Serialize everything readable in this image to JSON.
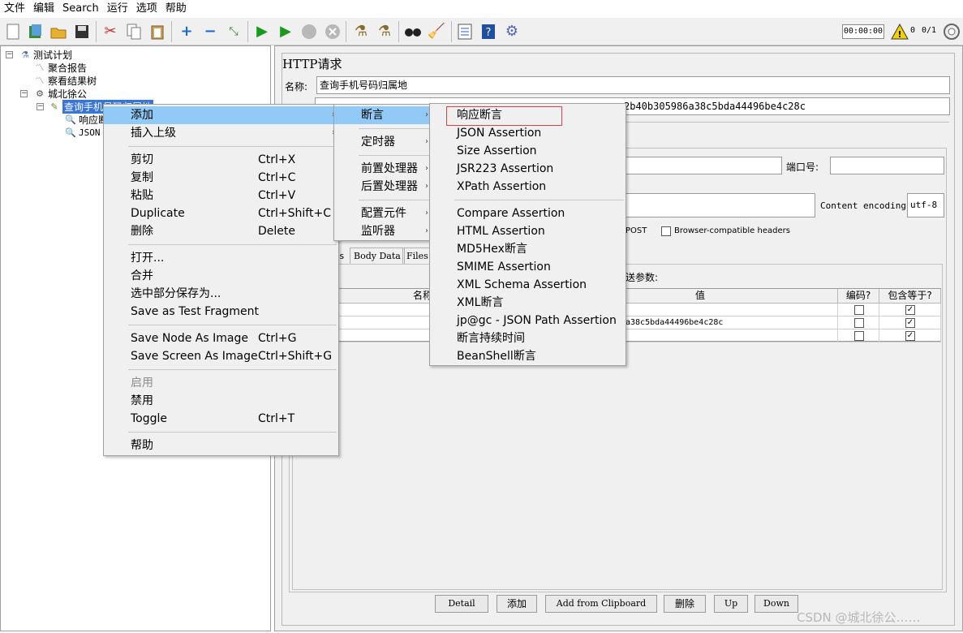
{
  "menubar": [
    "文件",
    "编辑",
    "Search",
    "运行",
    "选项",
    "帮助"
  ],
  "toolbar": {
    "timer": "00:00:00",
    "warning_count": "0",
    "thread_count": "0/1"
  },
  "tree": {
    "root": "测试计划",
    "aggregate_report": "聚合报告",
    "view_results_tree": "察看结果树",
    "thread_group": "城北徐公",
    "sampler": "查询手机号码归属地",
    "child_1": "响应断言",
    "child_2": "JSON"
  },
  "panel": {
    "title": "HTTP请求",
    "name_label": "名称:",
    "name_value": "查询手机号码归属地",
    "comment_visible": "2b40b305986a38c5bda44496be4c28c",
    "port_label": "端口号:",
    "encoding_label": "Content encoding:",
    "encoding_value": "utf-8",
    "post_label": "POST",
    "browser_headers_label": "Browser-compatible headers",
    "tab_params_visible": "s",
    "tab_body": "Body Data",
    "tab_files": "Files",
    "send_params_label": "送参数:",
    "table": {
      "columns": [
        "名称",
        "值",
        "编码?",
        "包含等于?"
      ],
      "rows": [
        {
          "value": "",
          "encode": false,
          "include_equals": true
        },
        {
          "value": "a38c5bda44496be4c28c",
          "encode": false,
          "include_equals": true
        },
        {
          "value": "",
          "encode": false,
          "include_equals": true
        }
      ]
    },
    "buttons": [
      "Detail",
      "添加",
      "Add from Clipboard",
      "删除",
      "Up",
      "Down"
    ]
  },
  "context_menu": {
    "items": [
      {
        "label": "添加",
        "shortcut": "",
        "submenu": true,
        "highlight": true
      },
      {
        "label": "插入上级",
        "shortcut": "",
        "submenu": true
      },
      {
        "label": "剪切",
        "shortcut": "Ctrl+X"
      },
      {
        "label": "复制",
        "shortcut": "Ctrl+C"
      },
      {
        "label": "粘贴",
        "shortcut": "Ctrl+V"
      },
      {
        "label": "Duplicate",
        "shortcut": "Ctrl+Shift+C"
      },
      {
        "label": "删除",
        "shortcut": "Delete"
      },
      {
        "label": "打开...",
        "shortcut": ""
      },
      {
        "label": "合并",
        "shortcut": ""
      },
      {
        "label": "选中部分保存为...",
        "shortcut": ""
      },
      {
        "label": "Save as Test Fragment",
        "shortcut": ""
      },
      {
        "label": "Save Node As Image",
        "shortcut": "Ctrl+G"
      },
      {
        "label": "Save Screen As Image",
        "shortcut": "Ctrl+Shift+G"
      },
      {
        "label": "启用",
        "shortcut": "",
        "disabled": true
      },
      {
        "label": "禁用",
        "shortcut": ""
      },
      {
        "label": "Toggle",
        "shortcut": "Ctrl+T"
      },
      {
        "label": "帮助",
        "shortcut": ""
      }
    ]
  },
  "add_submenu": {
    "items": [
      "断言",
      "定时器",
      "前置处理器",
      "后置处理器",
      "配置元件",
      "监听器"
    ]
  },
  "assertion_submenu": {
    "items": [
      "响应断言",
      "JSON Assertion",
      "Size Assertion",
      "JSR223 Assertion",
      "XPath Assertion",
      "Compare Assertion",
      "HTML Assertion",
      "MD5Hex断言",
      "SMIME Assertion",
      "XML Schema Assertion",
      "XML断言",
      "jp@gc - JSON Path Assertion",
      "断言持续时间",
      "BeanShell断言"
    ]
  },
  "watermark": "CSDN @城北徐公……",
  "colors": {
    "menu_highlight": "#91c9f7",
    "tree_selection": "#3875d7",
    "focus_box": "#e04040"
  }
}
